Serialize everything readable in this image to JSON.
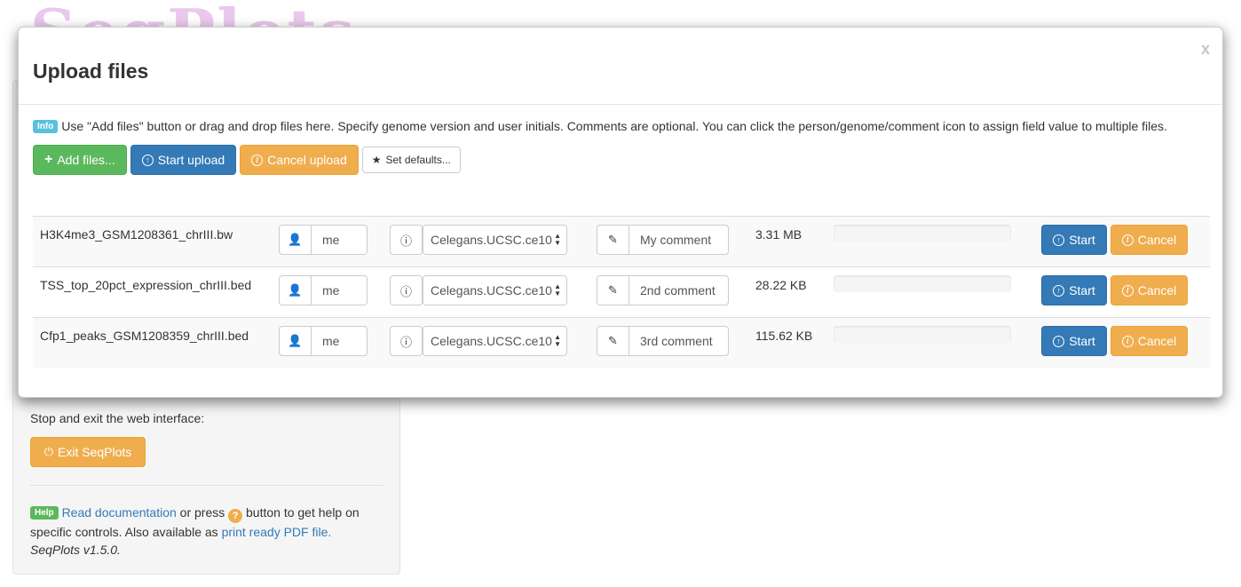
{
  "background": {
    "logo_text": "SeqPlots",
    "exit_prompt": "Stop and exit the web interface:",
    "exit_button": "Exit SeqPlots",
    "help_badge": "Help",
    "help_link": "Read documentation",
    "help_text_1": " or press ",
    "help_qmark": "?",
    "help_text_2": " button to get help on specific controls. Also available as ",
    "help_pdf_link": "print ready PDF file.",
    "version": "SeqPlots v1.5.0."
  },
  "modal": {
    "title": "Upload files",
    "close": "x",
    "info_badge": "Info",
    "info_text": "Use \"Add files\" button or drag and drop files here. Specify genome version and user initials. Comments are optional. You can click the person/genome/comment icon to assign field value to multiple files.",
    "toolbar": {
      "add_files": "Add files...",
      "start_upload": "Start upload",
      "cancel_upload": "Cancel upload",
      "set_defaults": "Set defaults..."
    },
    "files": [
      {
        "name": "H3K4me3_GSM1208361_chrIII.bw",
        "user": "me",
        "genome": "Celegans.UCSC.ce10",
        "comment": "My comment",
        "size": "3.31 MB",
        "start": "Start",
        "cancel": "Cancel"
      },
      {
        "name": "TSS_top_20pct_expression_chrIII.bed",
        "user": "me",
        "genome": "Celegans.UCSC.ce10",
        "comment": "2nd comment",
        "size": "28.22 KB",
        "start": "Start",
        "cancel": "Cancel"
      },
      {
        "name": "Cfp1_peaks_GSM1208359_chrIII.bed",
        "user": "me",
        "genome": "Celegans.UCSC.ce10",
        "comment": "3rd comment",
        "size": "115.62 KB",
        "start": "Start",
        "cancel": "Cancel"
      }
    ]
  },
  "colors": {
    "primary": "#337ab7",
    "warning": "#f0ad4e",
    "success": "#5cb85c",
    "info": "#5bc0de"
  }
}
